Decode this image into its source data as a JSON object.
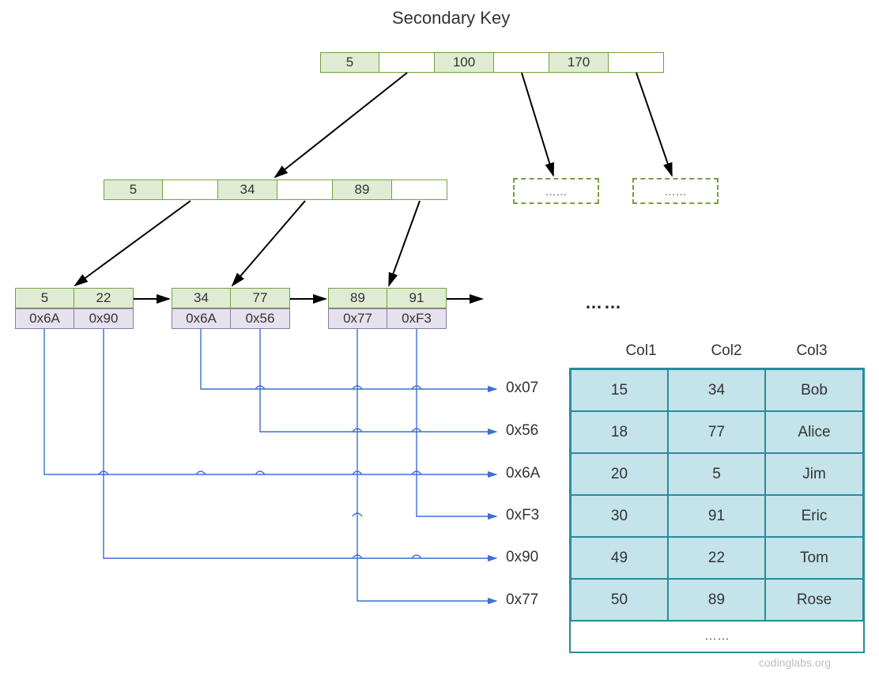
{
  "title": "Secondary Key",
  "root": {
    "keys": [
      "5",
      "100",
      "170"
    ]
  },
  "internal": {
    "keys": [
      "5",
      "34",
      "89"
    ]
  },
  "leaves": [
    {
      "keys": [
        "5",
        "22"
      ],
      "addrs": [
        "0x6A",
        "0x90"
      ]
    },
    {
      "keys": [
        "34",
        "77"
      ],
      "addrs": [
        "0x6A",
        "0x56"
      ]
    },
    {
      "keys": [
        "89",
        "91"
      ],
      "addrs": [
        "0x77",
        "0xF3"
      ]
    }
  ],
  "placeholder_text": "……",
  "leaf_continuation": "……",
  "row_addresses": [
    "0x07",
    "0x56",
    "0x6A",
    "0xF3",
    "0x90",
    "0x77"
  ],
  "columns": [
    "Col1",
    "Col2",
    "Col3"
  ],
  "rows": [
    [
      "15",
      "34",
      "Bob"
    ],
    [
      "18",
      "77",
      "Alice"
    ],
    [
      "20",
      "5",
      "Jim"
    ],
    [
      "30",
      "91",
      "Eric"
    ],
    [
      "49",
      "22",
      "Tom"
    ],
    [
      "50",
      "89",
      "Rose"
    ]
  ],
  "table_last_row": "……",
  "watermark": "codinglabs.org",
  "chart_data": {
    "type": "table",
    "description": "B+Tree secondary index diagram: leaf keys map to heap row addresses which point to rows in a data table.",
    "btree": {
      "root_keys": [
        5,
        100,
        170
      ],
      "internal_keys": [
        5,
        34,
        89
      ],
      "leaves": [
        {
          "keys": [
            5,
            22
          ],
          "row_pointers": [
            "0x6A",
            "0x90"
          ]
        },
        {
          "keys": [
            34,
            77
          ],
          "row_pointers": [
            "0x6A",
            "0x56"
          ]
        },
        {
          "keys": [
            89,
            91
          ],
          "row_pointers": [
            "0x77",
            "0xF3"
          ]
        }
      ]
    },
    "heap_rows_shown": [
      "0x07",
      "0x56",
      "0x6A",
      "0xF3",
      "0x90",
      "0x77"
    ],
    "table": {
      "columns": [
        "Col1",
        "Col2",
        "Col3"
      ],
      "rows": [
        [
          15,
          34,
          "Bob"
        ],
        [
          18,
          77,
          "Alice"
        ],
        [
          20,
          5,
          "Jim"
        ],
        [
          30,
          91,
          "Eric"
        ],
        [
          49,
          22,
          "Tom"
        ],
        [
          50,
          89,
          "Rose"
        ]
      ]
    }
  }
}
